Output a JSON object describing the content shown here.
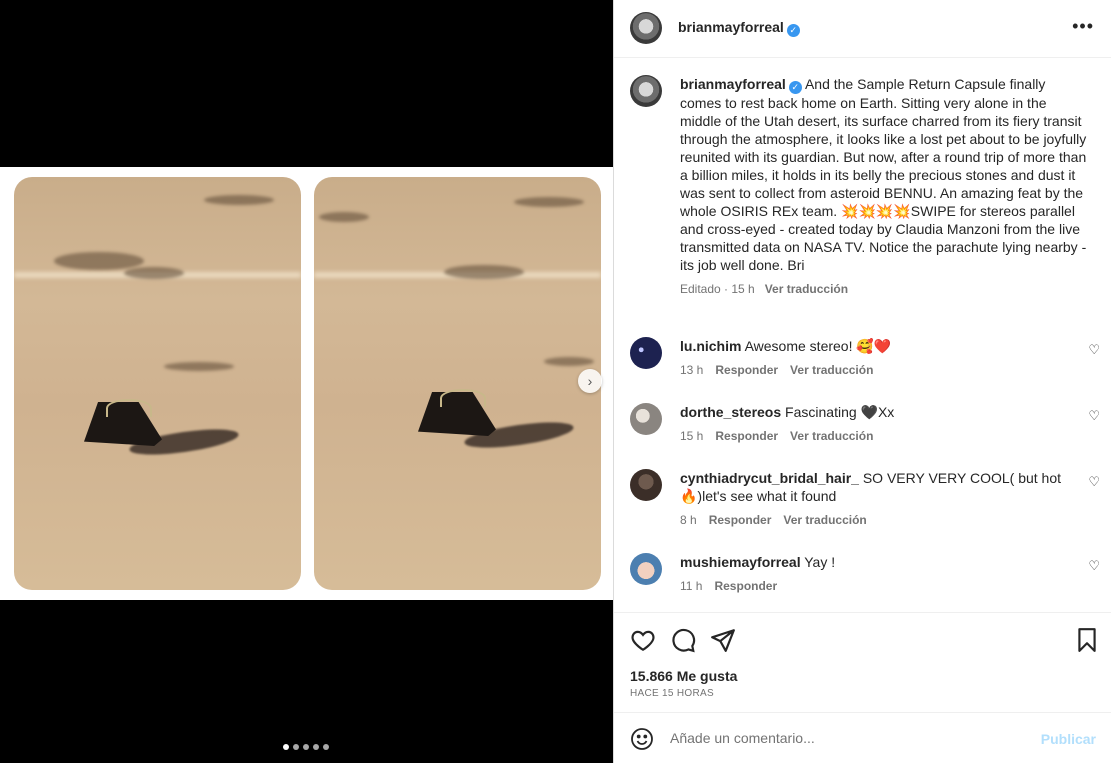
{
  "post": {
    "author": "brianmayforreal",
    "caption": "And the Sample Return Capsule finally comes to rest back home on Earth. Sitting very alone in the middle of the Utah desert, its surface charred from its fiery transit through the atmosphere, it looks like a lost pet about to be joyfully reunited with its guardian. But now, after a round trip of more than a billion miles, it holds in its belly the precious stones and dust it was sent to collect from asteroid BENNU. An amazing feat by the whole OSIRIS REx team. 💥💥💥💥SWIPE for stereos parallel and cross-eyed - created today by Claudia Manzoni from the live transmitted data on NASA TV. Notice the parachute lying nearby - its job well done. Bri",
    "edited_label": "Editado · 15 h",
    "translate_label": "Ver traducción",
    "carousel": {
      "total": 5,
      "active": 0
    }
  },
  "comments": [
    {
      "user": "lu.nichim",
      "text": "Awesome stereo! 🥰❤️",
      "time": "13 h",
      "reply": "Responder",
      "translate": "Ver traducción"
    },
    {
      "user": "dorthe_stereos",
      "text": "Fascinating 🖤Xx",
      "time": "15 h",
      "reply": "Responder",
      "translate": "Ver traducción"
    },
    {
      "user": "cynthiadrycut_bridal_hair_",
      "text": "SO VERY VERY COOL( but hot 🔥)let's see what it found",
      "time": "8 h",
      "reply": "Responder",
      "translate": "Ver traducción"
    },
    {
      "user": "mushiemayforreal",
      "text": "Yay !",
      "time": "11 h",
      "reply": "Responder"
    }
  ],
  "actions": {
    "likes": "15.866 Me gusta",
    "posted_ago": "HACE 15 HORAS"
  },
  "composer": {
    "placeholder": "Añade un comentario...",
    "post_label": "Publicar"
  },
  "icons": {
    "verified": "verified-badge-icon",
    "more": "more-options-icon",
    "like": "heart-icon",
    "comment": "comment-bubble-icon",
    "share": "paper-plane-icon",
    "save": "bookmark-icon",
    "emoji": "emoji-smiley-icon",
    "next": "chevron-right-icon"
  },
  "colors": {
    "verified": "#3897f0",
    "post_button": "#b2dffc"
  }
}
